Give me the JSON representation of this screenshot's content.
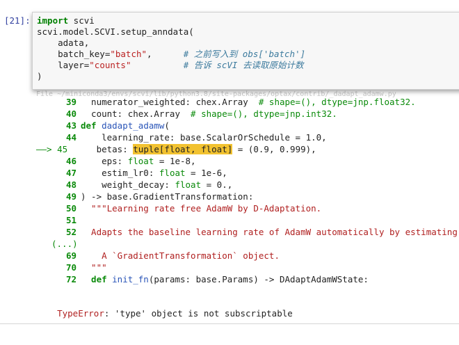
{
  "cell": {
    "prompt": "[21]:",
    "lines": [
      {
        "parts": [
          {
            "c": "kw",
            "t": "import"
          },
          {
            "c": "plain",
            "t": " scvi"
          }
        ]
      },
      {
        "parts": [
          {
            "c": "plain",
            "t": "scvi.model.SCVI.setup_anndata("
          }
        ]
      },
      {
        "parts": [
          {
            "c": "plain",
            "t": "    adata,"
          }
        ]
      },
      {
        "parts": [
          {
            "c": "plain",
            "t": "    batch_key="
          },
          {
            "c": "str",
            "t": "\"batch\""
          },
          {
            "c": "plain",
            "t": ",      "
          },
          {
            "c": "cmt",
            "t": "# 之前写入到 obs['batch']"
          }
        ]
      },
      {
        "parts": [
          {
            "c": "plain",
            "t": "    layer="
          },
          {
            "c": "str",
            "t": "\"counts\""
          },
          {
            "c": "plain",
            "t": "          "
          },
          {
            "c": "cmt",
            "t": "# 告诉 scVI 去读取原始计数"
          }
        ]
      },
      {
        "parts": [
          {
            "c": "plain",
            "t": ")"
          }
        ]
      }
    ]
  },
  "traceback": {
    "file_line": "File ~/miniconda3/envs/scvi/lib/python3.8/site-packages/optax/contrib/_dadapt_adamw.py",
    "lines": [
      {
        "num": "39",
        "parts": [
          {
            "c": "dark",
            "t": "  numerator_weighted: chex.Array  "
          },
          {
            "c": "green",
            "t": "# shape=(), dtype=jnp.float32."
          }
        ]
      },
      {
        "num": "40",
        "parts": [
          {
            "c": "dark",
            "t": "  count: chex.Array  "
          },
          {
            "c": "green",
            "t": "# shape=(), dtype=jnp.int32."
          }
        ]
      },
      {
        "num": "43",
        "parts": [
          {
            "c": "greenb",
            "t": "def "
          },
          {
            "c": "blue",
            "t": "dadapt_adamw"
          },
          {
            "c": "dark",
            "t": "("
          }
        ]
      },
      {
        "num": "44",
        "parts": [
          {
            "c": "dark",
            "t": "    learning_rate: base.ScalarOrSchedule = 1.0,"
          }
        ]
      },
      {
        "num": "45",
        "current": true,
        "arrow": "——> 45",
        "parts": [
          {
            "c": "dark",
            "t": "   betas: "
          },
          {
            "c": "hl",
            "t": "tuple[float, float]"
          },
          {
            "c": "dark",
            "t": " = (0.9, 0.999),"
          }
        ]
      },
      {
        "num": "46",
        "parts": [
          {
            "c": "dark",
            "t": "    eps: "
          },
          {
            "c": "green",
            "t": "float"
          },
          {
            "c": "dark",
            "t": " = 1e-8,"
          }
        ]
      },
      {
        "num": "47",
        "parts": [
          {
            "c": "dark",
            "t": "    estim_lr0: "
          },
          {
            "c": "green",
            "t": "float"
          },
          {
            "c": "dark",
            "t": " = 1e-6,"
          }
        ]
      },
      {
        "num": "48",
        "parts": [
          {
            "c": "dark",
            "t": "    weight_decay: "
          },
          {
            "c": "green",
            "t": "float"
          },
          {
            "c": "dark",
            "t": " = 0.,"
          }
        ]
      },
      {
        "num": "49",
        "parts": [
          {
            "c": "dark",
            "t": ") -> base.GradientTransformation:"
          }
        ]
      },
      {
        "num": "50",
        "parts": [
          {
            "c": "red",
            "t": "  \"\"\"Learning rate free AdamW by D-Adaptation."
          }
        ]
      },
      {
        "num": "51",
        "parts": [
          {
            "c": "dark",
            "t": ""
          }
        ]
      },
      {
        "num": "52",
        "parts": [
          {
            "c": "red",
            "t": "  Adapts the baseline learning rate of AdamW automatically by estimating the"
          }
        ]
      },
      {
        "num": "(...)",
        "ellipsis": true,
        "parts": []
      },
      {
        "num": "69",
        "parts": [
          {
            "c": "red",
            "t": "    A `GradientTransformation` object."
          }
        ]
      },
      {
        "num": "70",
        "parts": [
          {
            "c": "red",
            "t": "  \"\"\""
          }
        ]
      },
      {
        "num": "72",
        "parts": [
          {
            "c": "greenb",
            "t": "  def "
          },
          {
            "c": "blue",
            "t": "init_fn"
          },
          {
            "c": "dark",
            "t": "(params: base.Params) -> DAdaptAdamWState:"
          }
        ]
      }
    ],
    "error_name": "TypeError",
    "error_msg": ": 'type' object is not subscriptable"
  }
}
